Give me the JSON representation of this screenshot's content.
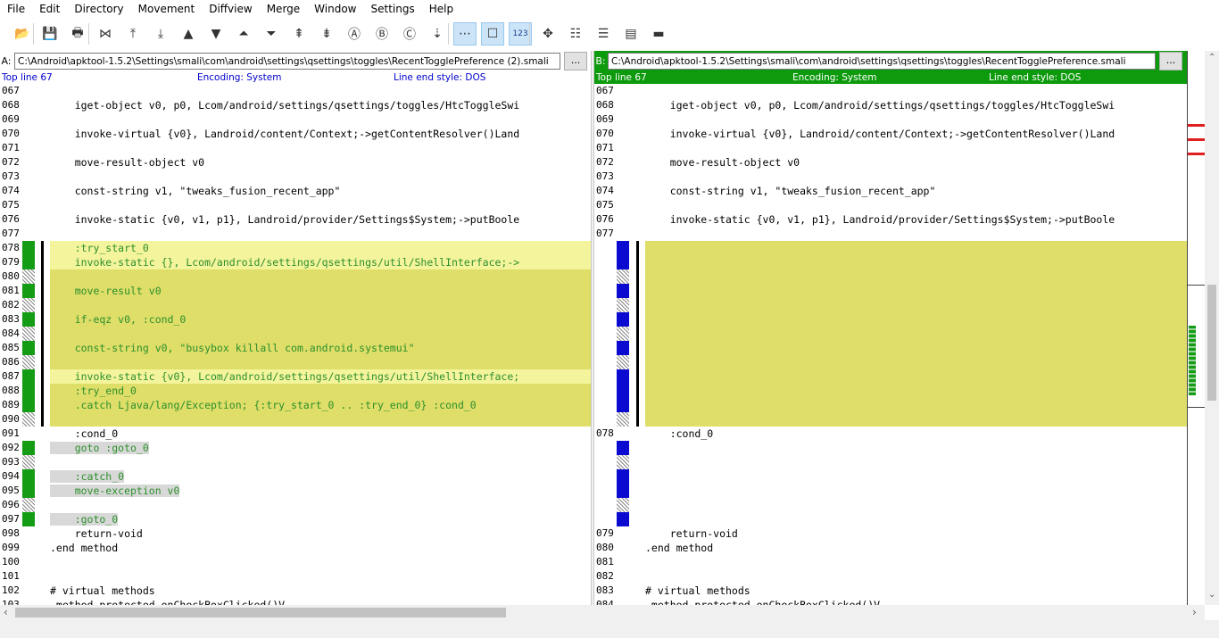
{
  "menu": [
    "File",
    "Edit",
    "Directory",
    "Movement",
    "Diffview",
    "Merge",
    "Window",
    "Settings",
    "Help"
  ],
  "toolbar": [
    {
      "icon": "open-folder-icon"
    },
    {
      "icon": "save-icon"
    },
    {
      "icon": "print-icon"
    },
    {
      "icon": "select-current-diff-icon"
    },
    {
      "icon": "goto-first-delta-icon"
    },
    {
      "icon": "goto-last-delta-icon"
    },
    {
      "icon": "prev-delta-icon"
    },
    {
      "icon": "next-delta-icon"
    },
    {
      "icon": "prev-conflict-icon"
    },
    {
      "icon": "next-conflict-icon"
    },
    {
      "icon": "prev-unsolved-icon"
    },
    {
      "icon": "next-unsolved-icon"
    },
    {
      "icon": "choose-a-icon"
    },
    {
      "icon": "choose-b-icon"
    },
    {
      "icon": "choose-c-icon"
    },
    {
      "icon": "auto-advance-icon"
    },
    {
      "icon": "show-whitespace-icon"
    },
    {
      "icon": "show-whitespace-in-diff-icon"
    },
    {
      "icon": "show-line-numbers-icon",
      "label": "123"
    },
    {
      "icon": "overview-icon"
    },
    {
      "icon": "split-diff-icon"
    },
    {
      "icon": "join-diffs-icon"
    },
    {
      "icon": "word-wrap-icon"
    },
    {
      "icon": "collapse-icon"
    }
  ],
  "left": {
    "label": "A:",
    "path": "C:\\Android\\apktool-1.5.2\\Settings\\smali\\com\\android\\settings\\qsettings\\toggles\\RecentTogglePreference (2).smali",
    "browse": "...",
    "top_line": "Top line 67",
    "encoding": "Encoding: System",
    "line_end": "Line end style: DOS",
    "rows": [
      {
        "n": "067",
        "t": "",
        "m": "",
        "k": "normal"
      },
      {
        "n": "068",
        "t": "    iget-object v0, p0, Lcom/android/settings/qsettings/toggles/HtcToggleSwi",
        "m": "",
        "k": "normal"
      },
      {
        "n": "069",
        "t": "",
        "m": "",
        "k": "normal"
      },
      {
        "n": "070",
        "t": "    invoke-virtual {v0}, Landroid/content/Context;->getContentResolver()Land",
        "m": "",
        "k": "normal"
      },
      {
        "n": "071",
        "t": "",
        "m": "",
        "k": "normal"
      },
      {
        "n": "072",
        "t": "    move-result-object v0",
        "m": "",
        "k": "normal"
      },
      {
        "n": "073",
        "t": "",
        "m": "",
        "k": "normal"
      },
      {
        "n": "074",
        "t": "    const-string v1, \"tweaks_fusion_recent_app\"",
        "m": "",
        "k": "normal"
      },
      {
        "n": "075",
        "t": "",
        "m": "",
        "k": "normal"
      },
      {
        "n": "076",
        "t": "    invoke-static {v0, v1, p1}, Landroid/provider/Settings$System;->putBoole",
        "m": "",
        "k": "normal"
      },
      {
        "n": "077",
        "t": "",
        "m": "",
        "k": "normal"
      },
      {
        "n": "078",
        "t": "    :try_start_0",
        "m": "green",
        "k": "diff-hl"
      },
      {
        "n": "079",
        "t": "    invoke-static {}, Lcom/android/settings/qsettings/util/ShellInterface;->",
        "m": "green",
        "k": "diff-hl"
      },
      {
        "n": "080",
        "t": "",
        "m": "hatch",
        "k": "diff"
      },
      {
        "n": "081",
        "t": "    move-result v0",
        "m": "green",
        "k": "diff"
      },
      {
        "n": "082",
        "t": "",
        "m": "hatch",
        "k": "diff"
      },
      {
        "n": "083",
        "t": "    if-eqz v0, :cond_0",
        "m": "green",
        "k": "diff"
      },
      {
        "n": "084",
        "t": "",
        "m": "hatch",
        "k": "diff"
      },
      {
        "n": "085",
        "t": "    const-string v0, \"busybox killall com.android.systemui\"",
        "m": "green",
        "k": "diff"
      },
      {
        "n": "086",
        "t": "",
        "m": "hatch",
        "k": "diff"
      },
      {
        "n": "087",
        "t": "    invoke-static {v0}, Lcom/android/settings/qsettings/util/ShellInterface;",
        "m": "green",
        "k": "diff-hl"
      },
      {
        "n": "088",
        "t": "    :try_end_0",
        "m": "green",
        "k": "diff"
      },
      {
        "n": "089",
        "t": "    .catch Ljava/lang/Exception; {:try_start_0 .. :try_end_0} :cond_0",
        "m": "green",
        "k": "diff"
      },
      {
        "n": "090",
        "t": "",
        "m": "hatch",
        "k": "diff"
      },
      {
        "n": "091",
        "t": "    :cond_0",
        "m": "",
        "k": "normal"
      },
      {
        "n": "092",
        "t": "    goto :goto_0",
        "m": "green",
        "k": "moved"
      },
      {
        "n": "093",
        "t": "",
        "m": "hatch",
        "k": "blank"
      },
      {
        "n": "094",
        "t": "    :catch_0",
        "m": "green",
        "k": "moved"
      },
      {
        "n": "095",
        "t": "    move-exception v0",
        "m": "green",
        "k": "moved"
      },
      {
        "n": "096",
        "t": "",
        "m": "hatch",
        "k": "blank"
      },
      {
        "n": "097",
        "t": "    :goto_0",
        "m": "green",
        "k": "moved"
      },
      {
        "n": "098",
        "t": "    return-void",
        "m": "",
        "k": "normal"
      },
      {
        "n": "099",
        "t": ".end method",
        "m": "",
        "k": "normal"
      },
      {
        "n": "100",
        "t": "",
        "m": "",
        "k": "normal"
      },
      {
        "n": "101",
        "t": "",
        "m": "",
        "k": "normal"
      },
      {
        "n": "102",
        "t": "# virtual methods",
        "m": "",
        "k": "normal"
      },
      {
        "n": "103",
        "t": ".method protected onCheckBoxClicked()V",
        "m": "",
        "k": "normal"
      }
    ]
  },
  "right": {
    "label": "B:",
    "path": "C:\\Android\\apktool-1.5.2\\Settings\\smali\\com\\android\\settings\\qsettings\\toggles\\RecentTogglePreference.smali",
    "browse": "...",
    "top_line": "Top line 67",
    "encoding": "Encoding: System",
    "line_end": "Line end style: DOS",
    "rows": [
      {
        "n": "067",
        "t": "",
        "m": "",
        "k": "normal"
      },
      {
        "n": "068",
        "t": "    iget-object v0, p0, Lcom/android/settings/qsettings/toggles/HtcToggleSwi",
        "m": "",
        "k": "normal"
      },
      {
        "n": "069",
        "t": "",
        "m": "",
        "k": "normal"
      },
      {
        "n": "070",
        "t": "    invoke-virtual {v0}, Landroid/content/Context;->getContentResolver()Land",
        "m": "",
        "k": "normal"
      },
      {
        "n": "071",
        "t": "",
        "m": "",
        "k": "normal"
      },
      {
        "n": "072",
        "t": "    move-result-object v0",
        "m": "",
        "k": "normal"
      },
      {
        "n": "073",
        "t": "",
        "m": "",
        "k": "normal"
      },
      {
        "n": "074",
        "t": "    const-string v1, \"tweaks_fusion_recent_app\"",
        "m": "",
        "k": "normal"
      },
      {
        "n": "075",
        "t": "",
        "m": "",
        "k": "normal"
      },
      {
        "n": "076",
        "t": "    invoke-static {v0, v1, p1}, Landroid/provider/Settings$System;->putBoole",
        "m": "",
        "k": "normal"
      },
      {
        "n": "077",
        "t": "",
        "m": "",
        "k": "normal"
      },
      {
        "n": "",
        "t": "",
        "m": "blue",
        "k": "diff"
      },
      {
        "n": "",
        "t": "",
        "m": "blue",
        "k": "diff"
      },
      {
        "n": "",
        "t": "",
        "m": "hatch",
        "k": "diff"
      },
      {
        "n": "",
        "t": "",
        "m": "blue",
        "k": "diff"
      },
      {
        "n": "",
        "t": "",
        "m": "hatch",
        "k": "diff"
      },
      {
        "n": "",
        "t": "",
        "m": "blue",
        "k": "diff"
      },
      {
        "n": "",
        "t": "",
        "m": "hatch",
        "k": "diff"
      },
      {
        "n": "",
        "t": "",
        "m": "blue",
        "k": "diff"
      },
      {
        "n": "",
        "t": "",
        "m": "hatch",
        "k": "diff"
      },
      {
        "n": "",
        "t": "",
        "m": "blue",
        "k": "diff"
      },
      {
        "n": "",
        "t": "",
        "m": "blue",
        "k": "diff"
      },
      {
        "n": "",
        "t": "",
        "m": "blue",
        "k": "diff"
      },
      {
        "n": "",
        "t": "",
        "m": "hatch",
        "k": "diff"
      },
      {
        "n": "078",
        "t": "    :cond_0",
        "m": "",
        "k": "normal"
      },
      {
        "n": "",
        "t": "",
        "m": "blue",
        "k": "blank"
      },
      {
        "n": "",
        "t": "",
        "m": "hatch",
        "k": "blank"
      },
      {
        "n": "",
        "t": "",
        "m": "blue",
        "k": "blank"
      },
      {
        "n": "",
        "t": "",
        "m": "blue",
        "k": "blank"
      },
      {
        "n": "",
        "t": "",
        "m": "hatch",
        "k": "blank"
      },
      {
        "n": "",
        "t": "",
        "m": "blue",
        "k": "blank"
      },
      {
        "n": "079",
        "t": "    return-void",
        "m": "",
        "k": "normal"
      },
      {
        "n": "080",
        "t": ".end method",
        "m": "",
        "k": "normal"
      },
      {
        "n": "081",
        "t": "",
        "m": "",
        "k": "normal"
      },
      {
        "n": "082",
        "t": "",
        "m": "",
        "k": "normal"
      },
      {
        "n": "083",
        "t": "# virtual methods",
        "m": "",
        "k": "normal"
      },
      {
        "n": "084",
        "t": ".method protected onCheckBoxClicked()V",
        "m": "",
        "k": "normal"
      }
    ]
  },
  "colors": {
    "diff_block": "#dede68",
    "diff_line_highlight": "#f4f49c",
    "moved_text": "#2c8f2c",
    "marker_a": "#149c14",
    "marker_b": "#0a0ad0",
    "active_header": "#0d9b0d",
    "location_removed": "#e02020"
  }
}
